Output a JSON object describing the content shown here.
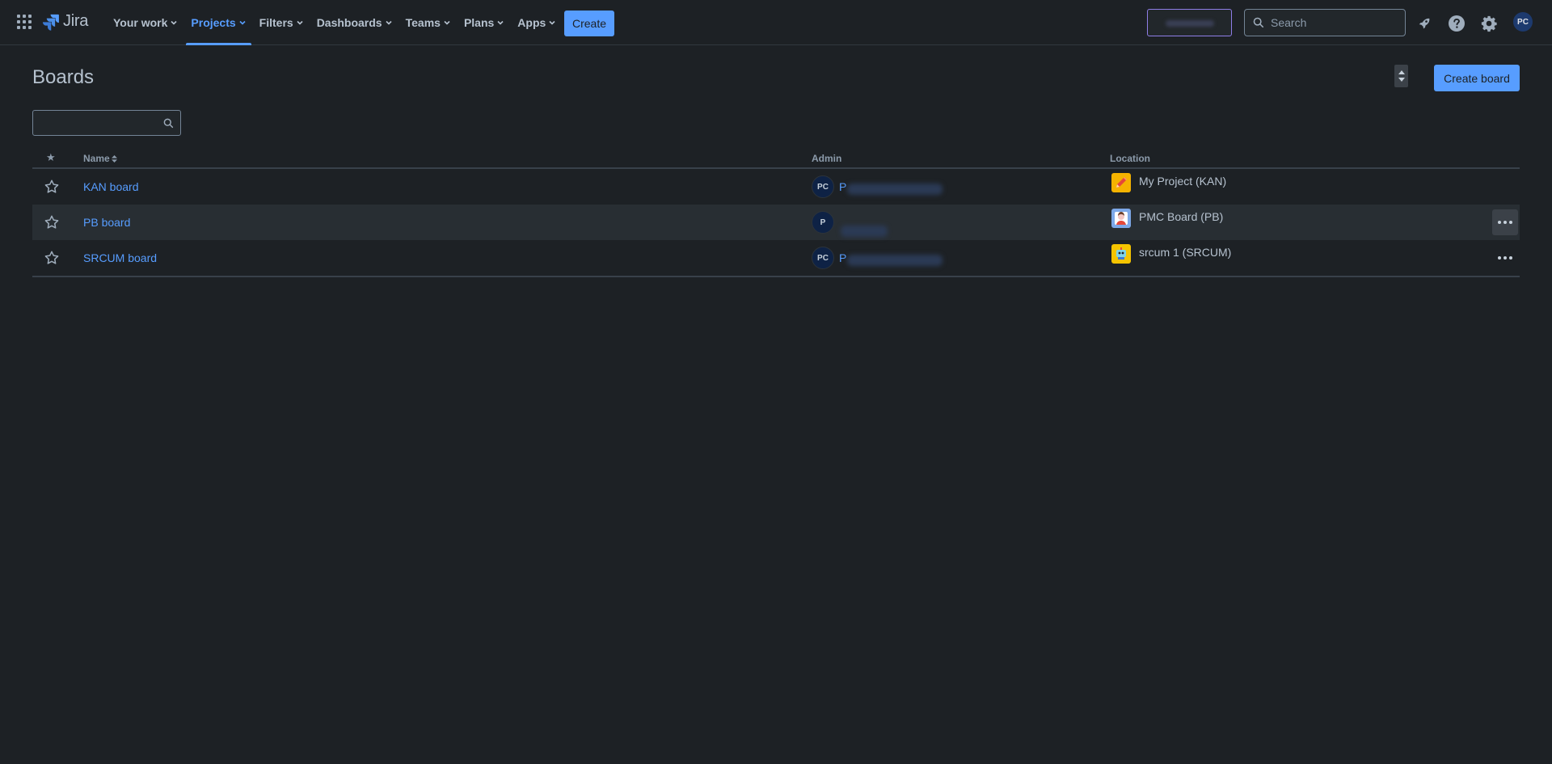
{
  "app": {
    "name": "Jira"
  },
  "nav": {
    "items": [
      {
        "label": "Your work",
        "active": false
      },
      {
        "label": "Projects",
        "active": true
      },
      {
        "label": "Filters",
        "active": false
      },
      {
        "label": "Dashboards",
        "active": false
      },
      {
        "label": "Teams",
        "active": false
      },
      {
        "label": "Plans",
        "active": false
      },
      {
        "label": "Apps",
        "active": false
      }
    ],
    "create_label": "Create",
    "search_placeholder": "Search",
    "user_initials": "PC"
  },
  "page": {
    "title": "Boards",
    "create_board_label": "Create board",
    "filter_placeholder": ""
  },
  "table": {
    "columns": {
      "star": "★",
      "name": "Name",
      "admin": "Admin",
      "location": "Location"
    },
    "rows": [
      {
        "name": "KAN board",
        "admin_initials": "PC",
        "admin_name_visible": "P",
        "location": "My Project (KAN)",
        "starred": false,
        "has_more": false
      },
      {
        "name": "PB board",
        "admin_initials": "P",
        "admin_name_visible": "",
        "location": "PMC Board (PB)",
        "starred": false,
        "has_more": true
      },
      {
        "name": "SRCUM board",
        "admin_initials": "PC",
        "admin_name_visible": "P",
        "location": "srcum 1 (SRCUM)",
        "starred": false,
        "has_more": true
      }
    ]
  },
  "colors": {
    "background": "#1d2125",
    "accent": "#579dff",
    "text": "#b6c2cf"
  }
}
